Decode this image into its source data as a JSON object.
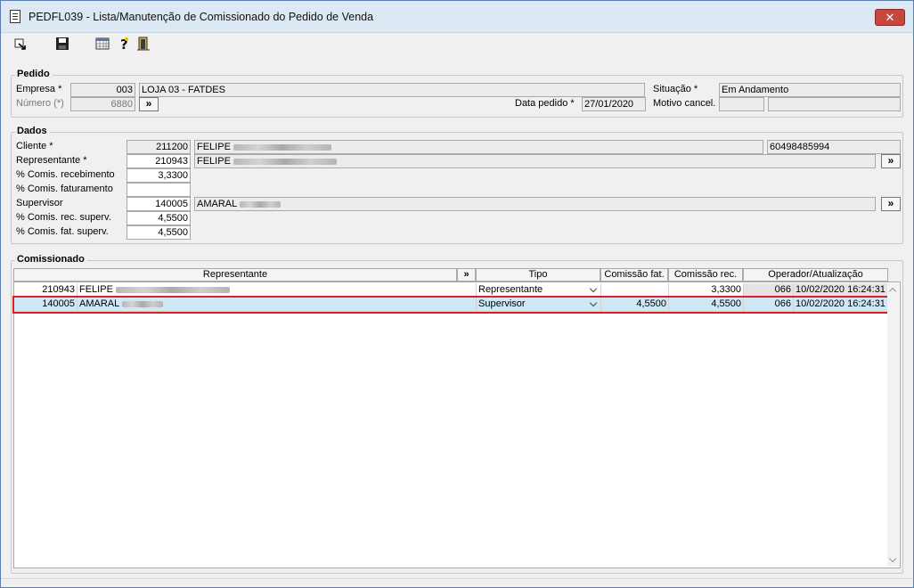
{
  "window": {
    "title": "PEDFL039 - Lista/Manutenção de Comissionado do Pedido de Venda",
    "close_label": "✕"
  },
  "pedido": {
    "group_label": "Pedido",
    "empresa_label": "Empresa *",
    "empresa_code": "003",
    "empresa_name": "LOJA 03 - FATDES",
    "numero_label": "Número (*)",
    "numero_value": "6880",
    "more_label": "»",
    "data_label": "Data pedido *",
    "data_value": "27/01/2020",
    "situacao_label": "Situação *",
    "situacao_value": "Em Andamento",
    "motivo_label": "Motivo cancel."
  },
  "dados": {
    "group_label": "Dados",
    "cliente_label": "Cliente *",
    "cliente_code": "211200",
    "cliente_name": "FELIPE",
    "cliente_doc": "60498485994",
    "representante_label": "Representante *",
    "representante_code": "210943",
    "representante_name": "FELIPE",
    "comis_receb_label": "% Comis. recebimento",
    "comis_receb_value": "3,3300",
    "comis_fat_label": "% Comis. faturamento",
    "comis_fat_value": "",
    "supervisor_label": "Supervisor",
    "supervisor_code": "140005",
    "supervisor_name": "AMARAL",
    "comis_rec_superv_label": "% Comis. rec. superv.",
    "comis_rec_superv_value": "4,5500",
    "comis_fat_superv_label": "% Comis. fat. superv.",
    "comis_fat_superv_value": "4,5500",
    "more_label": "»"
  },
  "comissionado": {
    "group_label": "Comissionado",
    "columns": [
      "Representante",
      "»",
      "Tipo",
      "Comissão fat.",
      "Comissão rec.",
      "Operador/Atualização"
    ],
    "rows": [
      {
        "code": "210943",
        "name": "FELIPE",
        "tipo": "Representante",
        "comissao_fat": "",
        "comissao_rec": "3,3300",
        "operador": "066",
        "atualizacao": "10/02/2020 16:24:31"
      },
      {
        "code": "140005",
        "name": "AMARAL",
        "tipo": "Supervisor",
        "comissao_fat": "4,5500",
        "comissao_rec": "4,5500",
        "operador": "066",
        "atualizacao": "10/02/2020 16:24:31"
      }
    ]
  }
}
